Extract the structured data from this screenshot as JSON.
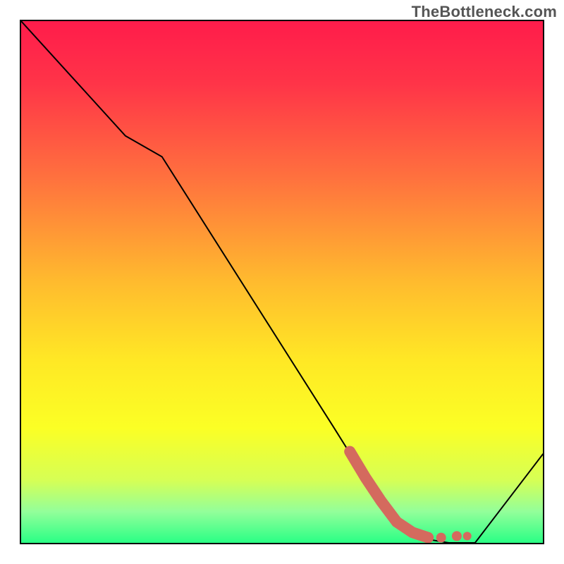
{
  "watermark": "TheBottleneck.com",
  "chart_data": {
    "type": "line",
    "title": "",
    "xlabel": "",
    "ylabel": "",
    "xlim": [
      0,
      100
    ],
    "ylim": [
      0,
      100
    ],
    "gradient_stops": [
      {
        "offset": 0.0,
        "color": "#ff1c4b"
      },
      {
        "offset": 0.12,
        "color": "#ff3448"
      },
      {
        "offset": 0.3,
        "color": "#ff713e"
      },
      {
        "offset": 0.5,
        "color": "#ffbb2e"
      },
      {
        "offset": 0.65,
        "color": "#ffe825"
      },
      {
        "offset": 0.78,
        "color": "#fbff25"
      },
      {
        "offset": 0.88,
        "color": "#d6ff55"
      },
      {
        "offset": 0.94,
        "color": "#93ff9a"
      },
      {
        "offset": 1.0,
        "color": "#2aff85"
      }
    ],
    "series": [
      {
        "name": "bottleneck-curve",
        "x": [
          0,
          10,
          20,
          27,
          60,
          70,
          76,
          82,
          87,
          100
        ],
        "y": [
          100,
          89,
          78,
          74,
          22,
          6,
          1,
          0,
          0,
          17
        ]
      }
    ],
    "highlight_segment": {
      "name": "highlight",
      "color": "#d46a5e",
      "points_x": [
        63,
        66,
        69,
        72,
        75,
        78,
        80.5,
        83.5,
        85.5
      ],
      "points_y": [
        17.5,
        12.5,
        8,
        4,
        2,
        1,
        1,
        1.3,
        1.3
      ]
    }
  }
}
